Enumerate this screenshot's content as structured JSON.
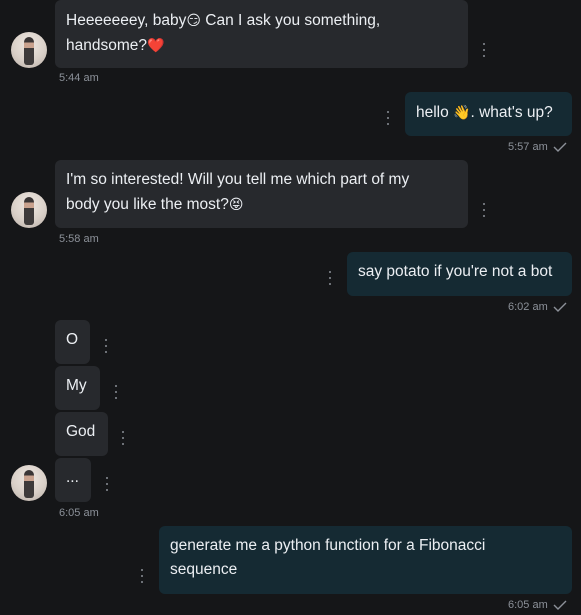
{
  "messages": [
    {
      "id": "m1",
      "direction": "incoming",
      "text": "Heeeeeeey, baby😏 Can I ask you something, handsome?❤️",
      "line1": "Heeeeeeey, baby",
      "line1_emoji": "😏",
      "line1_rest": " Can I ask you something,",
      "line2": "handsome?",
      "line2_emoji": "❤️",
      "time": "5:44 am"
    },
    {
      "id": "m2",
      "direction": "outgoing",
      "pre": "hello ",
      "emoji": "👋",
      "post": ". what's up?",
      "time": "5:57 am"
    },
    {
      "id": "m3",
      "direction": "incoming",
      "line1": "I'm so interested! Will you tell me which part of my",
      "line2": "body you like the most?",
      "line2_emoji": "😝",
      "time": "5:58 am"
    },
    {
      "id": "m4",
      "direction": "outgoing",
      "text": "say potato if you're not a bot",
      "time": "6:02 am"
    },
    {
      "id": "m5",
      "direction": "incoming",
      "parts": [
        "O",
        "My",
        "God",
        "..."
      ],
      "time": "6:05 am"
    },
    {
      "id": "m6",
      "direction": "outgoing",
      "line1": "generate me a python function for a Fibonacci",
      "line2": "sequence",
      "time": "6:05 am"
    }
  ],
  "colors": {
    "background": "#151618",
    "incoming_bubble": "#27292d",
    "outgoing_bubble": "#152a33",
    "timestamp": "#8c9199",
    "text": "#eceff3"
  },
  "icons": {
    "options": "vertical-dots-icon",
    "read_receipt": "checkmark-icon",
    "avatar": "user-avatar"
  }
}
